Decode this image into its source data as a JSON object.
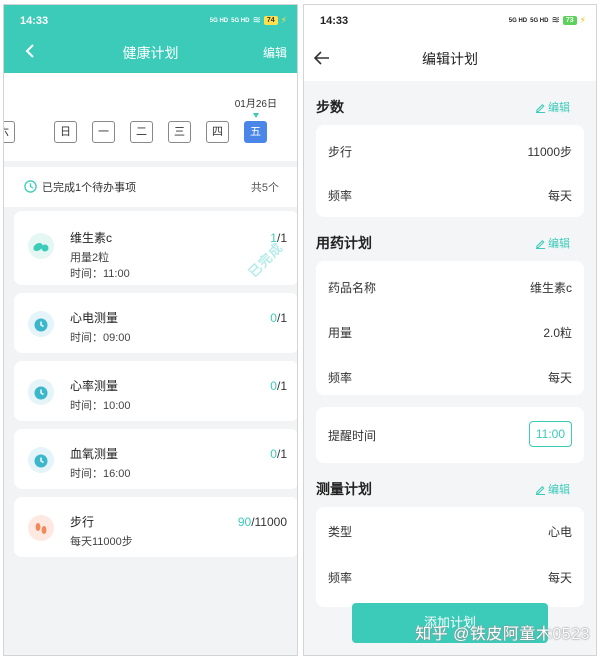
{
  "left": {
    "status": {
      "time": "14:33",
      "signal1": "5G HD",
      "signal2": "5G HD",
      "battery": "74"
    },
    "nav": {
      "title": "健康计划",
      "edit": "编辑"
    },
    "calendar": {
      "date": "01月26日",
      "days": [
        "六",
        "日",
        "一",
        "二",
        "三",
        "四",
        "五"
      ],
      "selected_index": 6
    },
    "summary": {
      "text": "已完成1个待办事项",
      "count": "共5个"
    },
    "tasks": [
      {
        "title": "维生素c",
        "line1": "用量2粒",
        "line2": "时间：11:00",
        "done": "1",
        "total": "/1",
        "stamp": "已完成",
        "icon": "pill-icon"
      },
      {
        "title": "心电测量",
        "line1": "时间：09:00",
        "done": "0",
        "total": "/1",
        "icon": "alarm-clock-icon"
      },
      {
        "title": "心率测量",
        "line1": "时间：10:00",
        "done": "0",
        "total": "/1",
        "icon": "alarm-clock-icon"
      },
      {
        "title": "血氧测量",
        "line1": "时间：16:00",
        "done": "0",
        "total": "/1",
        "icon": "alarm-clock-icon"
      },
      {
        "title": "步行",
        "line1": "每天11000步",
        "done": "90",
        "total": "/11000",
        "icon": "footprints-icon"
      }
    ]
  },
  "right": {
    "status": {
      "time": "14:33",
      "signal1": "5G HD",
      "signal2": "5G HD",
      "battery": "73"
    },
    "nav": {
      "title": "编辑计划"
    },
    "sections": {
      "steps": {
        "title": "步数",
        "edit": "编辑",
        "rows": [
          {
            "k": "步行",
            "v": "11000步"
          },
          {
            "k": "频率",
            "v": "每天"
          }
        ]
      },
      "med": {
        "title": "用药计划",
        "edit": "编辑",
        "rows": [
          {
            "k": "药品名称",
            "v": "维生素c"
          },
          {
            "k": "用量",
            "v": "2.0粒"
          },
          {
            "k": "频率",
            "v": "每天"
          }
        ],
        "reminder_label": "提醒时间",
        "reminder_time": "11:00"
      },
      "measure": {
        "title": "测量计划",
        "edit": "编辑",
        "rows": [
          {
            "k": "类型",
            "v": "心电"
          },
          {
            "k": "频率",
            "v": "每天"
          }
        ]
      }
    },
    "add_button": "添加计划",
    "watermark": "知乎 @铁皮阿童木0523"
  },
  "colors": {
    "accent": "#3ccbb9",
    "selected_day": "#4a86e8",
    "stamp": "#b6ecea"
  }
}
